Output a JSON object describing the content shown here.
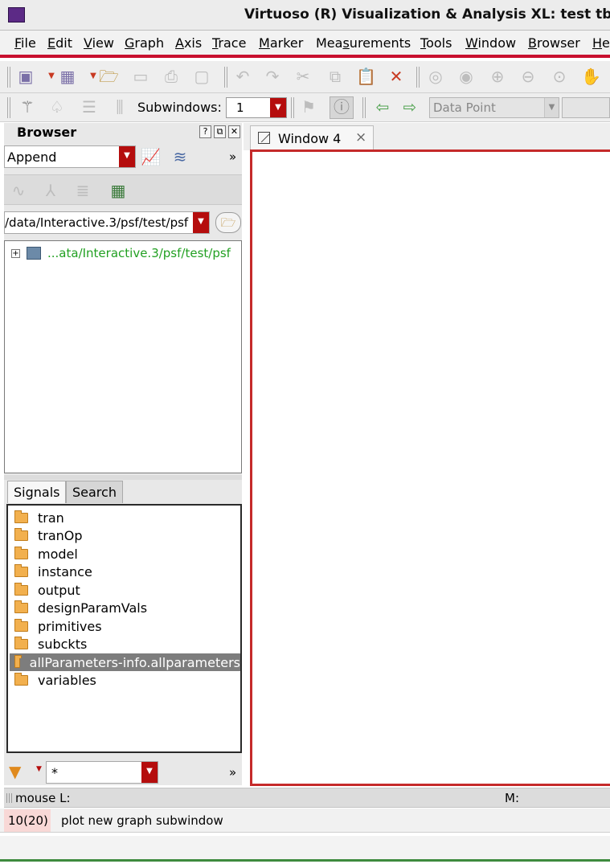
{
  "app": {
    "title": "Virtuoso (R) Visualization & Analysis XL: test tb_",
    "icon": "waveform-app-icon"
  },
  "menu": [
    {
      "pre": "",
      "u": "F",
      "post": "ile"
    },
    {
      "pre": "",
      "u": "E",
      "post": "dit"
    },
    {
      "pre": "",
      "u": "V",
      "post": "iew"
    },
    {
      "pre": "",
      "u": "G",
      "post": "raph"
    },
    {
      "pre": "",
      "u": "A",
      "post": "xis"
    },
    {
      "pre": "",
      "u": "T",
      "post": "race"
    },
    {
      "pre": "",
      "u": "M",
      "post": "arker"
    },
    {
      "pre": "Mea",
      "u": "s",
      "post": "urements"
    },
    {
      "pre": "",
      "u": "T",
      "post": "ools"
    },
    {
      "pre": "",
      "u": "W",
      "post": "indow"
    },
    {
      "pre": "",
      "u": "B",
      "post": "rowser"
    },
    {
      "pre": "",
      "u": "H",
      "post": "e"
    }
  ],
  "toolbar2": {
    "subwindows_label": "Subwindows:",
    "subwindows_value": "1",
    "datapoint_value": "Data Point"
  },
  "browser": {
    "title": "Browser",
    "header_buttons": [
      "?",
      "⧉",
      "✕"
    ],
    "mode": "Append",
    "path": "/data/Interactive.3/psf/test/psf",
    "tree_root": "...ata/Interactive.3/psf/test/psf",
    "tabs": [
      "Signals",
      "Search"
    ],
    "signals": [
      "tran",
      "tranOp",
      "model",
      "instance",
      "output",
      "designParamVals",
      "primitives",
      "subckts",
      "allParameters-info.allparameters",
      "variables"
    ],
    "selected_signal": "allParameters-info.allparameters",
    "filter_value": "*",
    "overflow": "»"
  },
  "graph": {
    "tab_label": "Window 4",
    "tab_close": "×"
  },
  "status": {
    "mouse_label": "mouse L:",
    "m_label": "M:",
    "command_count": "10(20)",
    "command_text": "plot new graph subwindow"
  },
  "colors": {
    "accent_red": "#c8102e",
    "tree_path_green": "#22a022",
    "selection_gray": "#7d7d7d"
  }
}
